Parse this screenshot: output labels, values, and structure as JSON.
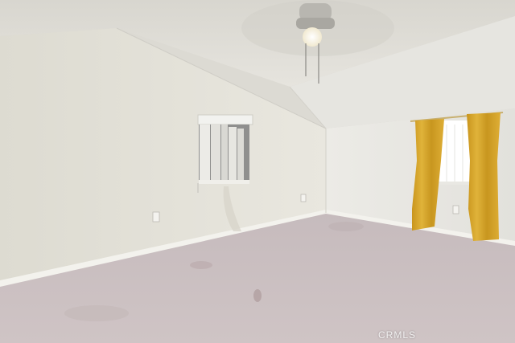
{
  "scene": {
    "description_kind": "photo",
    "watermark": "CRMLS",
    "colors": {
      "wall_left": "#e3e1d8",
      "wall_right": "#e9e8e2",
      "ceiling": "#dedcd6",
      "carpet": "#c9bdbf",
      "curtain": "#d4a52a",
      "baseboard": "#f2f1ec"
    },
    "objects": [
      "ceiling-fan",
      "window-with-vertical-blinds",
      "window-with-curtains",
      "carpet-floor",
      "electrical-outlets"
    ]
  }
}
